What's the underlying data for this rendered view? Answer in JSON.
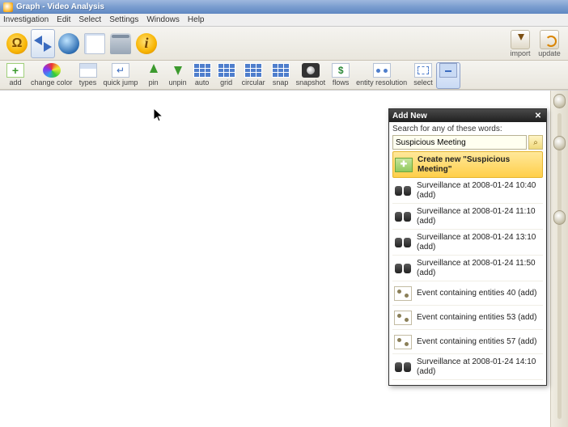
{
  "window": {
    "title": "Graph - Video Analysis"
  },
  "menu": [
    "Investigation",
    "Edit",
    "Select",
    "Settings",
    "Windows",
    "Help"
  ],
  "toolbar_big_right": {
    "import": "import",
    "update": "update"
  },
  "toolbar_small": {
    "add": "add",
    "change_color": "change color",
    "types": "types",
    "quick_jump": "quick jump",
    "pin": "pin",
    "unpin": "unpin",
    "auto": "auto",
    "grid": "grid",
    "circular": "circular",
    "snap": "snap",
    "snapshot": "snapshot",
    "flows": "flows",
    "entity_resolution": "entity resolution",
    "select": "select"
  },
  "dialog": {
    "title": "Add New",
    "search_label": "Search for any of these words:",
    "search_value": "Suspicious Meeting",
    "go_glyph": "⌕",
    "close_glyph": "✕",
    "results": [
      {
        "icon": "new",
        "text": "Create new \"Suspicious Meeting\"",
        "highlight": true
      },
      {
        "icon": "bino",
        "text": "Surveillance at 2008-01-24 10:40 (add)"
      },
      {
        "icon": "bino",
        "text": "Surveillance at 2008-01-24 11:10 (add)"
      },
      {
        "icon": "bino",
        "text": "Surveillance at 2008-01-24 13:10 (add)"
      },
      {
        "icon": "bino",
        "text": "Surveillance at 2008-01-24 11:50 (add)"
      },
      {
        "icon": "ent",
        "text": "Event containing entities 40 (add)"
      },
      {
        "icon": "ent",
        "text": "Event containing entities 53 (add)"
      },
      {
        "icon": "ent",
        "text": "Event containing entities 57 (add)"
      },
      {
        "icon": "bino",
        "text": "Surveillance at 2008-01-24 14:10 (add)"
      }
    ]
  }
}
